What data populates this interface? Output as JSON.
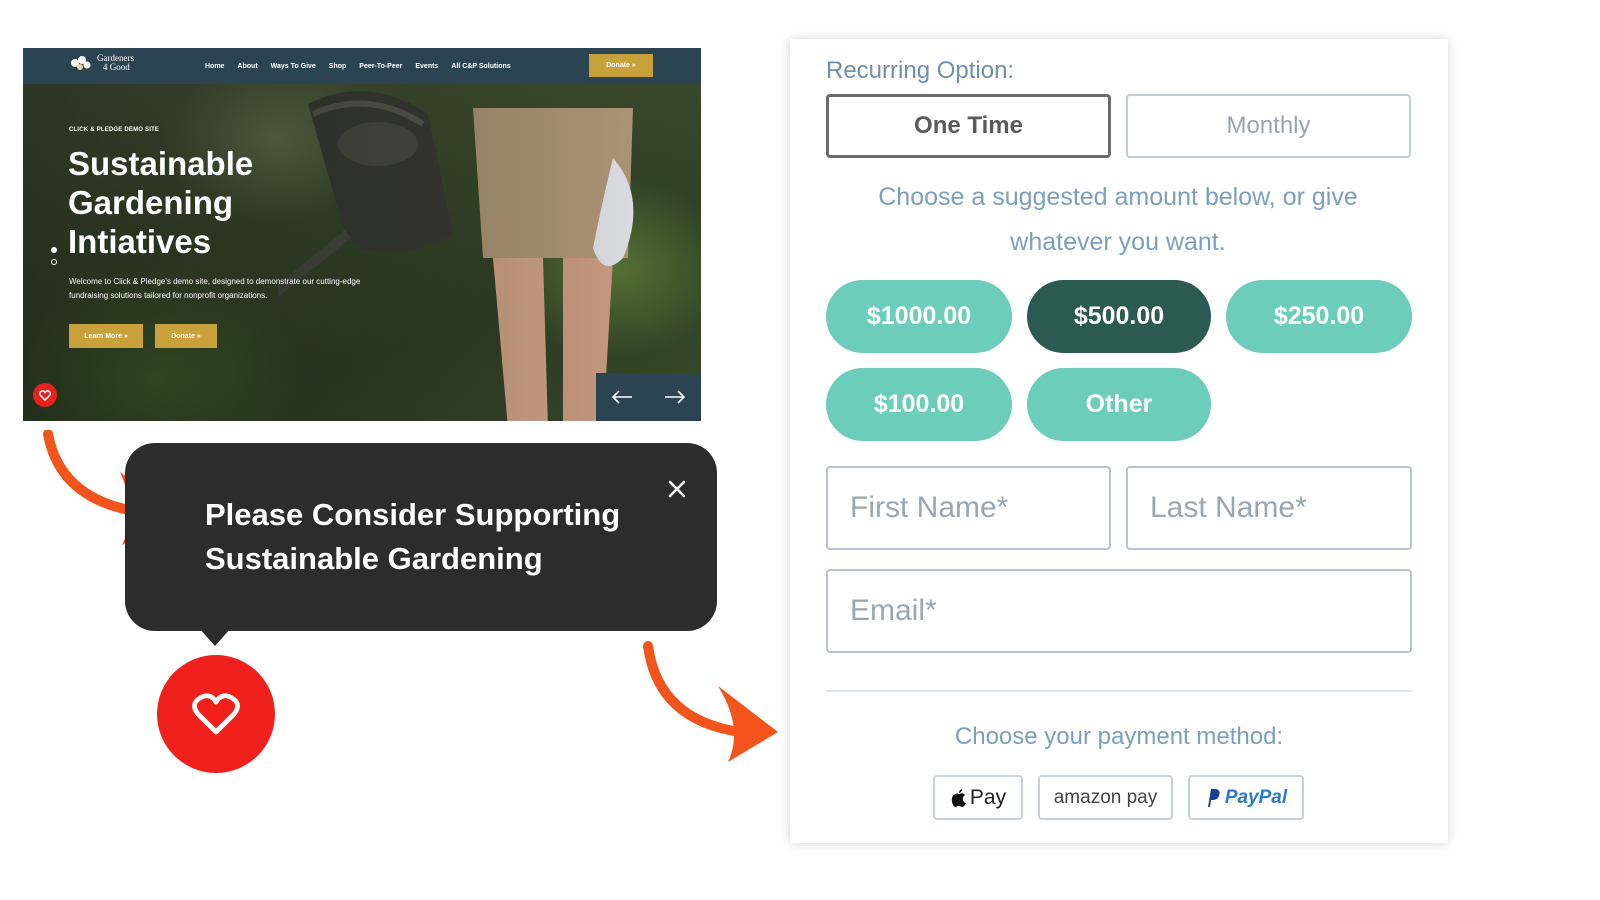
{
  "website": {
    "logo_text_line1": "Gardeners",
    "logo_text_line2": "4 Good",
    "nav": [
      "Home",
      "About",
      "Ways To Give",
      "Shop",
      "Peer-To-Peer",
      "Events",
      "All C&P Solutions"
    ],
    "nav_donate_label": "Donate »",
    "hero_eyebrow": "CLICK & PLEDGE DEMO SITE",
    "hero_title_line1": "Sustainable",
    "hero_title_line2": "Gardening",
    "hero_title_line3": "Intiatives",
    "hero_description": "Welcome to Click & Pledge's demo site, designed to demonstrate our cutting-edge fundraising solutions tailored for nonprofit organizations.",
    "learn_more_label": "Learn More »",
    "hero_donate_label": "Donate »",
    "icons": [
      "heart-icon",
      "arrow-left-icon",
      "arrow-right-icon"
    ]
  },
  "tooltip": {
    "message_line1": "Please Consider Supporting",
    "message_line2": "Sustainable Gardening",
    "close_icon": "close-icon"
  },
  "form": {
    "recurring_label": "Recurring Option:",
    "options": [
      {
        "label": "One Time",
        "selected": true
      },
      {
        "label": "Monthly",
        "selected": false
      }
    ],
    "suggest_line1": "Choose a suggested amount below, or give",
    "suggest_line2": "whatever you want.",
    "amounts": [
      {
        "label": "$1000.00",
        "selected": false
      },
      {
        "label": "$500.00",
        "selected": true
      },
      {
        "label": "$250.00",
        "selected": false
      },
      {
        "label": "$100.00",
        "selected": false
      },
      {
        "label": "Other",
        "selected": false
      }
    ],
    "first_name_placeholder": "First Name*",
    "last_name_placeholder": "Last Name*",
    "email_placeholder": "Email*",
    "payment_label": "Choose your payment method:",
    "payment_methods": [
      "Pay",
      "amazon pay",
      "PayPal"
    ]
  },
  "colors": {
    "accent_orange": "#f2541b",
    "heart_red": "#f0201c",
    "nav_dark": "#2b4452",
    "gold": "#c8a13a",
    "teal": "#6ccdbb",
    "teal_selected": "#2a5a52",
    "tooltip_bg": "#2c2c2c"
  }
}
